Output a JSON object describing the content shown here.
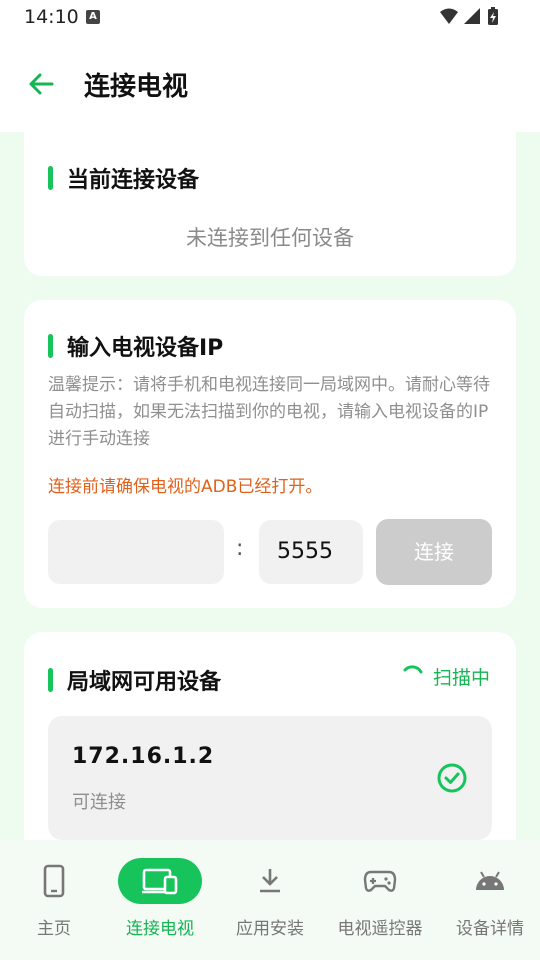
{
  "status": {
    "time": "14:10",
    "notif": "A"
  },
  "app_bar": {
    "title": "连接电视"
  },
  "current_card": {
    "title": "当前连接设备",
    "empty": "未连接到任何设备"
  },
  "ip_card": {
    "title": "输入电视设备IP",
    "hint": "温馨提示：请将手机和电视连接同一局域网中。请耐心等待自动扫描，如果无法扫描到你的电视，请输入电视设备的IP进行手动连接",
    "warning": "连接前请确保电视的ADB已经打开。",
    "ip_value": "",
    "colon": ":",
    "port": "5555",
    "connect_label": "连接"
  },
  "lan_card": {
    "title": "局域网可用设备",
    "scan_label": "扫描中",
    "devices": [
      {
        "ip": "172.16.1.2",
        "status": "可连接"
      }
    ]
  },
  "nav": {
    "items": [
      {
        "label": "主页",
        "icon": "phone-icon"
      },
      {
        "label": "连接电视",
        "icon": "devices-icon",
        "active": true
      },
      {
        "label": "应用安装",
        "icon": "download-icon"
      },
      {
        "label": "电视遥控器",
        "icon": "gamepad-icon"
      },
      {
        "label": "设备详情",
        "icon": "android-icon"
      }
    ]
  },
  "colors": {
    "accent": "#16c45b",
    "warning": "#e0611c",
    "background": "#eefbef"
  }
}
